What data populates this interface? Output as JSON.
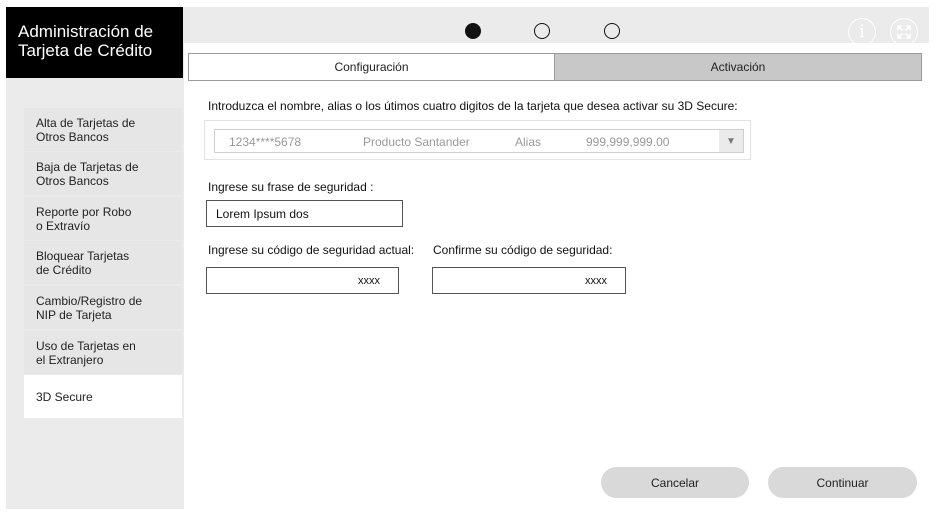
{
  "app": {
    "title": "Administración de\nTarjeta de Crédito"
  },
  "sidebar": {
    "items": [
      {
        "label": "Alta de Tarjetas de\nOtros Bancos",
        "active": false
      },
      {
        "label": "Baja de Tarjetas de\nOtros Bancos",
        "active": false
      },
      {
        "label": "Reporte por Robo\no Extravío",
        "active": false
      },
      {
        "label": "Bloquear Tarjetas\nde Crédito",
        "active": false
      },
      {
        "label": "Cambio/Registro de\nNIP de Tarjeta",
        "active": false
      },
      {
        "label": "Uso de Tarjetas en\nel Extranjero",
        "active": false
      },
      {
        "label": "3D Secure",
        "active": true
      }
    ]
  },
  "stepper": {
    "current_step": 1,
    "total_steps": 3
  },
  "topbar_icons": [
    "info-icon",
    "fullscreen-icon"
  ],
  "tabs": [
    {
      "label": "Configuración",
      "active": true
    },
    {
      "label": "Activación",
      "active": false
    }
  ],
  "form": {
    "card_prompt": "Introduzca el nombre, alias o los útimos cuatro digitos de la tarjeta que desea activar su 3D Secure:",
    "card_select": {
      "number": "1234****5678",
      "product": "Producto Santander",
      "alias": "Alias",
      "amount": "999,999,999.00"
    },
    "phrase_label": "Ingrese su frase de seguridad :",
    "phrase_value": "Lorem Ipsum dos",
    "code_label": "Ingrese su código de seguridad actual:",
    "code_value": "xxxx",
    "confirm_label": "Confirme su código de seguridad:",
    "confirm_value": "xxxx"
  },
  "actions": {
    "cancel": "Cancelar",
    "continue": "Continuar"
  },
  "colors": {
    "header_bg": "#000000",
    "panel_bg": "#ebebeb",
    "inactive_tab": "#c8c8c8",
    "button_bg": "#d9d9d9"
  }
}
